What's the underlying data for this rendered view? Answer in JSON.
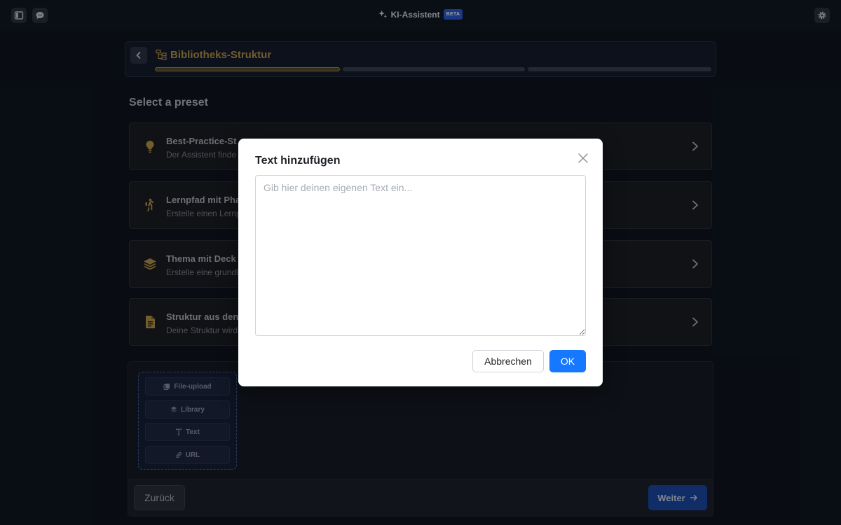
{
  "app": {
    "title": "KI-Assistent",
    "badge": "BETA"
  },
  "header": {
    "title": "Bibliotheks-Struktur",
    "steps_total": 3,
    "step_current": 1
  },
  "section_title": "Select a preset",
  "presets": [
    {
      "title": "Best-Practice-St",
      "desc": "Der Assistent finde",
      "icon": "lightbulb-icon"
    },
    {
      "title": "Lernpfad mit Pha",
      "desc": "Erstelle einen Lernp",
      "icon": "hiker-icon"
    },
    {
      "title": "Thema mit Deck",
      "desc": "Erstelle eine grundl",
      "icon": "layers-icon"
    },
    {
      "title": "Struktur aus den",
      "desc": "Deine Struktur wird",
      "icon": "document-icon"
    }
  ],
  "sources": [
    {
      "label": "File-upload",
      "icon": "copy-icon"
    },
    {
      "label": "Library",
      "icon": "layers-icon"
    },
    {
      "label": "Text",
      "icon": "text-icon"
    },
    {
      "label": "URL",
      "icon": "link-icon"
    }
  ],
  "footer": {
    "back_label": "Zurück",
    "next_label": "Weiter"
  },
  "modal": {
    "title": "Text hinzufügen",
    "placeholder": "Gib hier deinen eigenen Text ein...",
    "value": "",
    "cancel_label": "Abbrechen",
    "ok_label": "OK"
  },
  "colors": {
    "accent_gold": "#b8974a",
    "primary_blue": "#1677ff",
    "background": "#0f1520"
  }
}
